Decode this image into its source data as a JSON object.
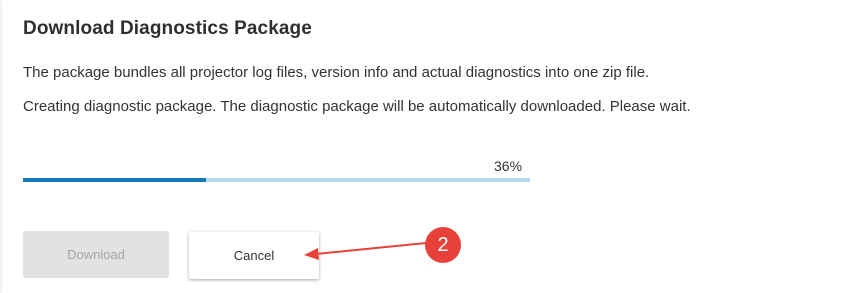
{
  "dialog": {
    "title": "Download Diagnostics Package",
    "description": "The package bundles all projector log files, version info and actual diagnostics into one zip file.",
    "status": "Creating diagnostic package. The diagnostic package will be automatically downloaded. Please wait.",
    "progress": {
      "value": 0.36,
      "label": "36%"
    },
    "buttons": {
      "download_label": "Download",
      "download_enabled": false,
      "cancel_label": "Cancel"
    }
  },
  "annotation": {
    "badge_number": "2",
    "color": "#e8413a"
  },
  "colors": {
    "progress_fill": "#1a78b4",
    "progress_track": "#b7d9ee"
  }
}
